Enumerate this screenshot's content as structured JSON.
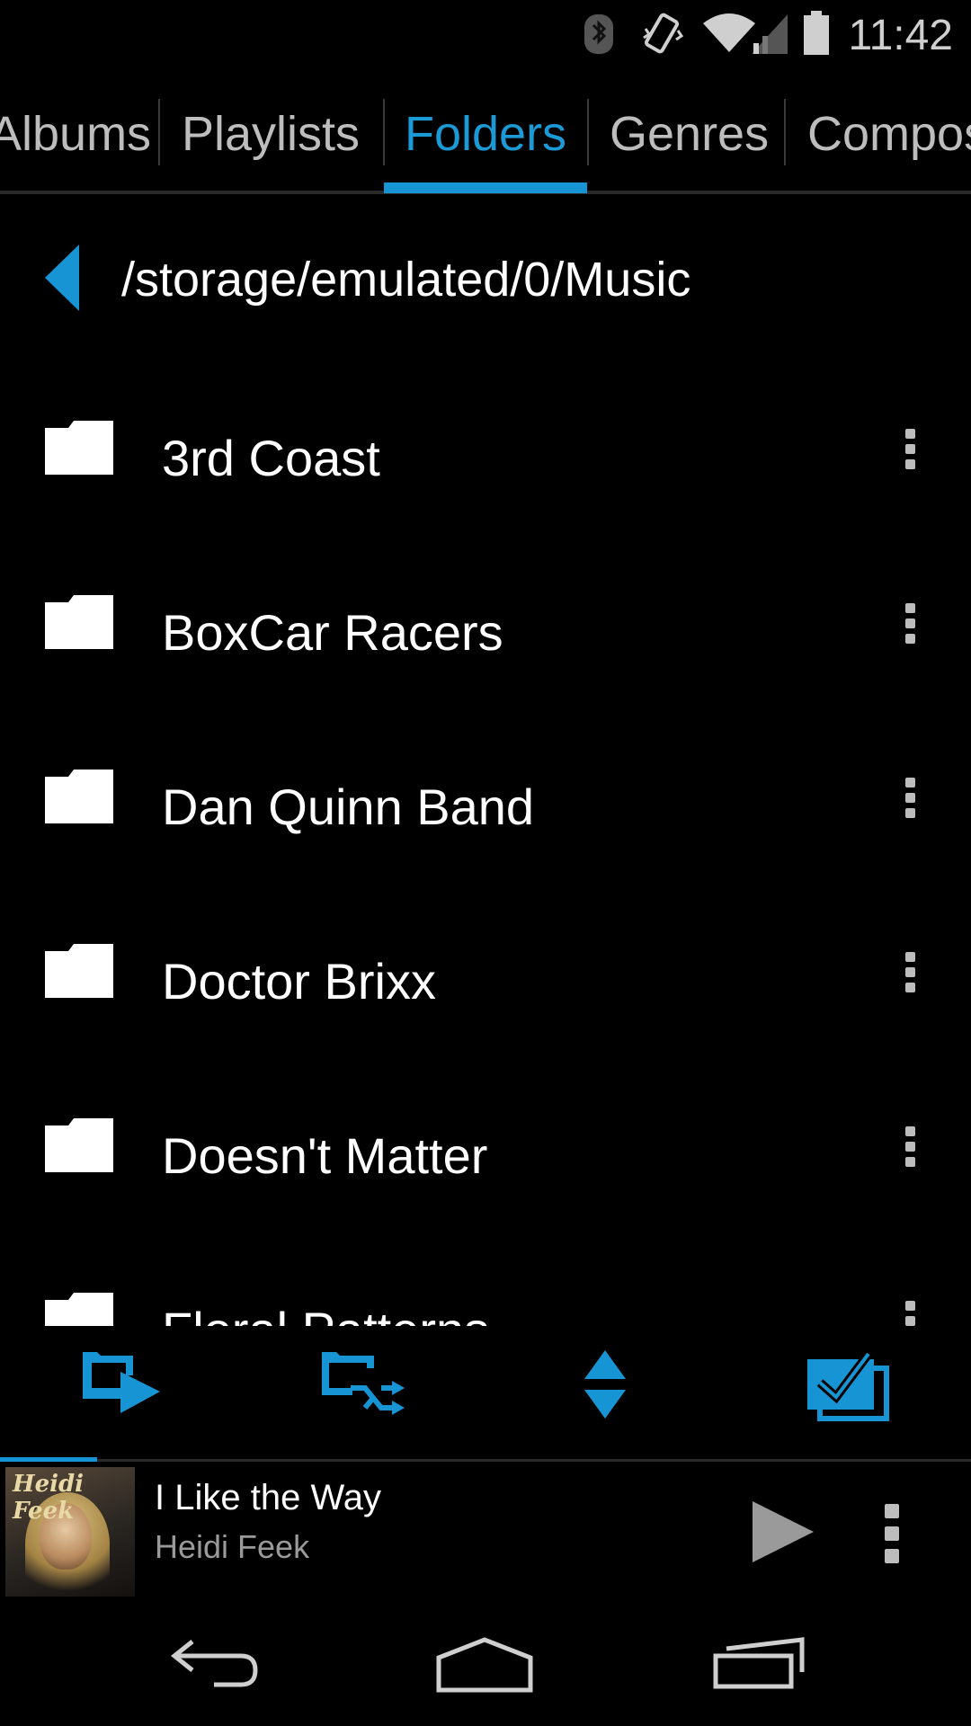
{
  "status_bar": {
    "time": "11:42"
  },
  "tabs": [
    {
      "label": "Albums",
      "active": false
    },
    {
      "label": "Playlists",
      "active": false
    },
    {
      "label": "Folders",
      "active": true
    },
    {
      "label": "Genres",
      "active": false
    },
    {
      "label": "Composers",
      "active": false
    }
  ],
  "path": {
    "current": "/storage/emulated/0/Music"
  },
  "folders": [
    {
      "name": "3rd Coast"
    },
    {
      "name": "BoxCar Racers"
    },
    {
      "name": "Dan Quinn Band"
    },
    {
      "name": "Doctor Brixx"
    },
    {
      "name": "Doesn't Matter"
    },
    {
      "name": "Floral Patterns"
    }
  ],
  "action_bar": {
    "icons": [
      "play-folder-icon",
      "shuffle-folder-icon",
      "sort-icon",
      "select-all-icon"
    ]
  },
  "now_playing": {
    "title": "I Like the Way",
    "artist": "Heidi Feek",
    "album_art_text": "Heidi Feek",
    "progress": 0.1
  },
  "colors": {
    "accent": "#1694d3",
    "background": "#000000",
    "text": "#ffffff",
    "secondary_text": "#9a9a9a"
  }
}
